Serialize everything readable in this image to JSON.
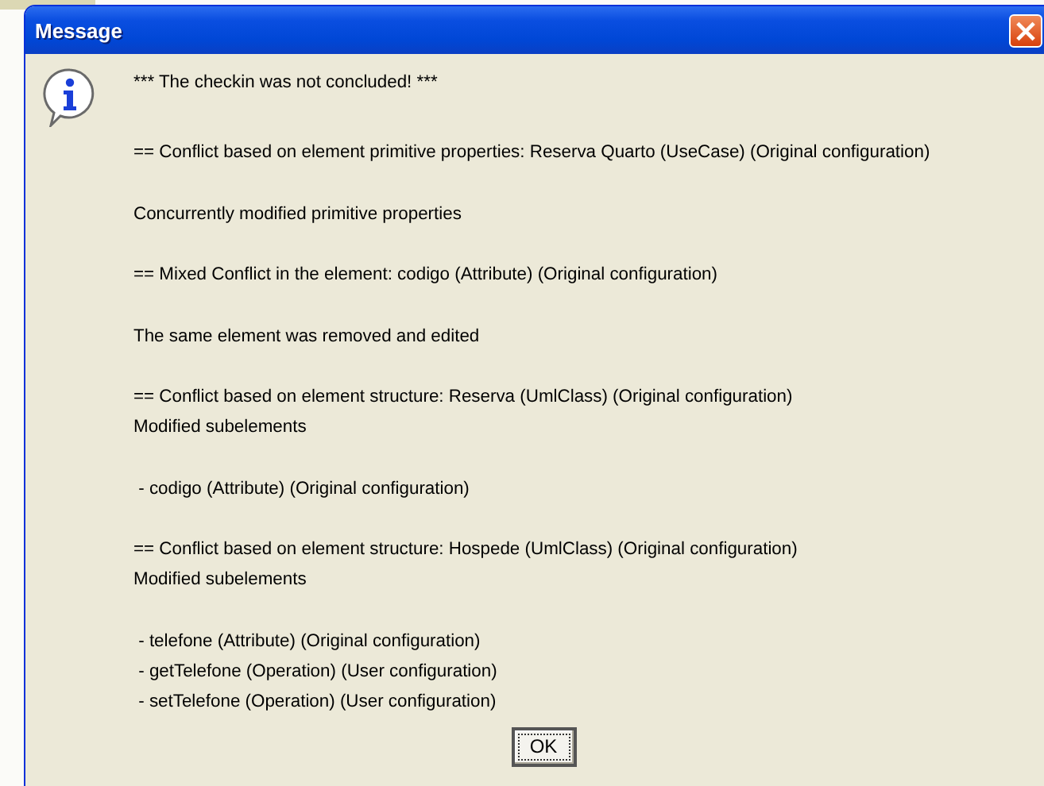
{
  "window": {
    "title": "Message",
    "close": "×"
  },
  "message": {
    "kind": "information",
    "paragraphs": [
      [
        "*** The checkin was not concluded! ***"
      ],
      [
        "== Conflict based on element primitive properties: Reserva Quarto (UseCase) (Original configuration)"
      ],
      [
        "Concurrently modified primitive properties"
      ],
      [
        "== Mixed Conflict in the element: codigo (Attribute) (Original configuration)"
      ],
      [
        "The same element was removed and edited"
      ],
      [
        "== Conflict based on element structure: Reserva (UmlClass) (Original configuration)",
        "Modified subelements"
      ],
      [
        " - codigo (Attribute) (Original configuration)"
      ],
      [
        "== Conflict based on element structure: Hospede (UmlClass) (Original configuration)",
        "Modified subelements"
      ],
      [
        " - telefone (Attribute) (Original configuration)",
        " - getTelefone (Operation) (User configuration)",
        " - setTelefone (Operation) (User configuration)"
      ]
    ]
  },
  "buttons": [
    {
      "label": "OK",
      "selected": true
    }
  ]
}
